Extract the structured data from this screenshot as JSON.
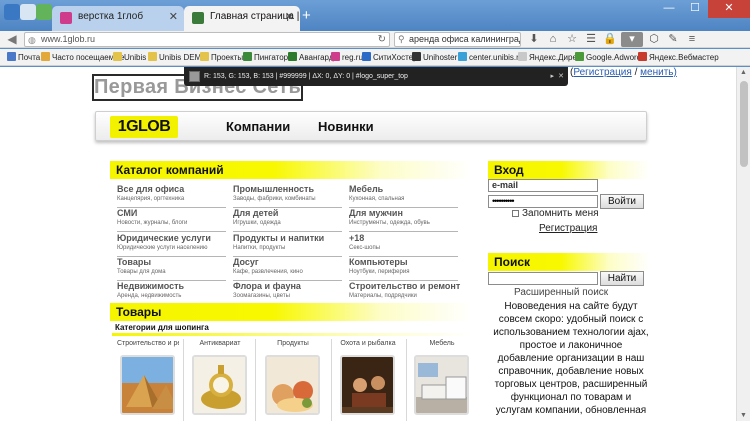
{
  "browser": {
    "tabs": [
      {
        "title": "верстка 1глоб"
      },
      {
        "title": "Главная страница | Перва..."
      }
    ],
    "url": "www.1glob.ru",
    "search_value": "аренда офиса калининград",
    "bookmarks": [
      {
        "label": "Почта",
        "color": "#4a78c8"
      },
      {
        "label": "Часто посещаемые",
        "color": "#e3a83a"
      },
      {
        "label": "Unibis",
        "color": "#e3c34a"
      },
      {
        "label": "Unibis DEMO",
        "color": "#e3c34a"
      },
      {
        "label": "Проекты",
        "color": "#e3c34a"
      },
      {
        "label": "Пингатор",
        "color": "#3a8a3a"
      },
      {
        "label": "Авангард",
        "color": "#2c7a2c"
      },
      {
        "label": "reg.ru",
        "color": "#d03c8c"
      },
      {
        "label": "СитиХостер",
        "color": "#2c6ac8"
      },
      {
        "label": "Unihoster",
        "color": "#333333"
      },
      {
        "label": "center.unibis.ru",
        "color": "#3aa0d8"
      },
      {
        "label": "Яндекс.Директ",
        "color": "#c8c8c8"
      },
      {
        "label": "Google.Adwords",
        "color": "#4a9a3a"
      },
      {
        "label": "Яндекс.Вебмастер",
        "color": "#c83a2c"
      }
    ]
  },
  "picker": {
    "info": "R: 153, G: 153, B: 153 | #999999 | ΔX: 0, ΔY: 0 | #logo_super_top",
    "swatch_color": "#999999"
  },
  "page": {
    "logo_text": "Первая Бизнес Сеть",
    "register_link": "Регистрация",
    "register_suffix": "менить)",
    "logo_box": "1GLOB",
    "menu": [
      "Компании",
      "Новинки"
    ],
    "catalog_title": "Каталог компаний",
    "catalog": [
      {
        "name": "Все для офиса",
        "sub": "Канцелярия, оргтехника"
      },
      {
        "name": "Промышленность",
        "sub": "Заводы, фабрики, комбинаты"
      },
      {
        "name": "Мебель",
        "sub": "Кухонная, спальная"
      },
      {
        "name": "СМИ",
        "sub": "Новости, журналы, блоги"
      },
      {
        "name": "Для детей",
        "sub": "Игрушки, одежда"
      },
      {
        "name": "Для мужчин",
        "sub": "Инструменты, одежда, обувь"
      },
      {
        "name": "Юридические услуги",
        "sub": "Юридические услуги населению"
      },
      {
        "name": "Продукты и напитки",
        "sub": "Напитки, продукты"
      },
      {
        "name": "+18",
        "sub": "Секс-шопы"
      },
      {
        "name": "Товары",
        "sub": "Товары для дома"
      },
      {
        "name": "Досуг",
        "sub": "Кафе, развлечения, кино"
      },
      {
        "name": "Компьютеры",
        "sub": "Ноутбуки, периферия"
      },
      {
        "name": "Недвижимость",
        "sub": "Аренда, недвижимость"
      },
      {
        "name": "Флора и фауна",
        "sub": "Зоомагазины, цветы"
      },
      {
        "name": "Строительство и ремонт",
        "sub": "Материалы, подрядчики"
      }
    ],
    "goods_title": "Товары",
    "goods_subtitle": "Категории для шопинга",
    "products": [
      {
        "label": "Строительство и ремонт"
      },
      {
        "label": "Антиквариат"
      },
      {
        "label": "Продукты"
      },
      {
        "label": "Охота и рыбалка"
      },
      {
        "label": "Мебель"
      }
    ]
  },
  "login": {
    "title": "Вход",
    "email_placeholder": "e-mail",
    "password_mask": "••••••••••",
    "submit": "Войти",
    "remember": "Запомнить меня",
    "register": "Регистрация"
  },
  "search": {
    "title": "Поиск",
    "submit": "Найти",
    "advanced": "Расширенный поиск",
    "news": "Нововедения на сайте будут совсем скоро: удобный поиск с использованием технологии ajax, простое и лаконичное добавление организации в наш справочник, добавление новых торговых центров, расширенный функционал по товарам и услугам компании, обновленная"
  },
  "colors": {
    "accent_yellow": "#f5f500",
    "title_bar": "#5a8fc7"
  }
}
